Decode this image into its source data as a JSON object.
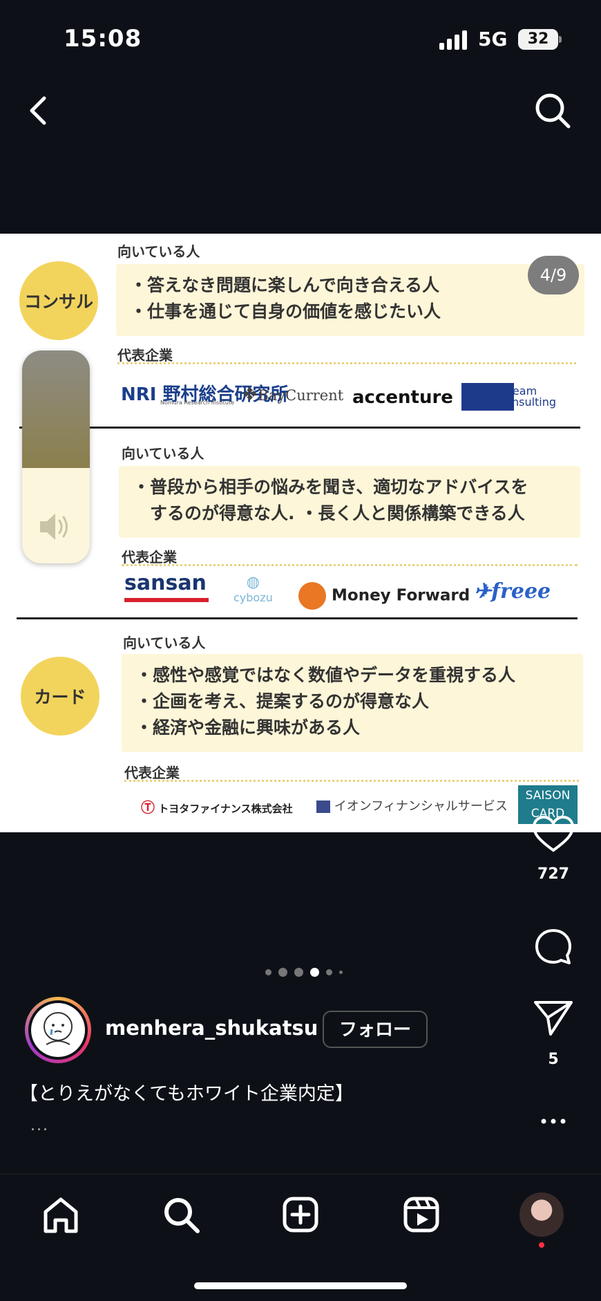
{
  "status_bar": {
    "time": "15:08",
    "network": "5G",
    "battery": "32"
  },
  "post": {
    "page_indicator": "4/9",
    "sections": [
      {
        "circle_label": "コンサル",
        "suited_heading": "向いている人",
        "suited_lines": [
          "・答えなき問題に楽しんで向き合える人",
          "・仕事を通じて自身の価値を感じたい人"
        ],
        "companies_heading": "代表企業",
        "companies": [
          "NRI 野村総合研究所",
          "BayCurrent",
          "accenture",
          "ABeam Consulting"
        ]
      },
      {
        "circle_label": "",
        "suited_heading": "向いている人",
        "suited_lines": [
          "・普段から相手の悩みを聞き、適切なアドバイスを",
          "　するのが得意な人. ・長く人と関係構築できる人"
        ],
        "companies_heading": "代表企業",
        "companies": [
          "sansan",
          "cybozu",
          "Money Forward",
          "freee"
        ]
      },
      {
        "circle_label": "カード",
        "suited_heading": "向いている人",
        "suited_lines": [
          "・感性や感覚ではなく数値やデータを重視する人",
          "・企画を考え、提案するのが得意な人",
          "・経済や金融に興味がある人"
        ],
        "companies_heading": "代表企業",
        "companies": [
          "トヨタファイナンス株式会社",
          "イオンフィナンシャルサービス",
          "SAISON CARD"
        ]
      }
    ],
    "nri_sub": "Nomura Research Institute",
    "volume_level": 0.45
  },
  "actions": {
    "likes": "727",
    "shares": "5"
  },
  "author": {
    "username": "menhera_shukatsu",
    "follow_label": "フォロー"
  },
  "caption": {
    "text": "【とりえがなくてもホワイト企業内定】",
    "more": "..."
  },
  "carousel": {
    "count": 6,
    "active_index": 3
  },
  "colors": {
    "background": "#0d1117",
    "circle": "#f2d45c",
    "box": "#fdf6d8"
  }
}
